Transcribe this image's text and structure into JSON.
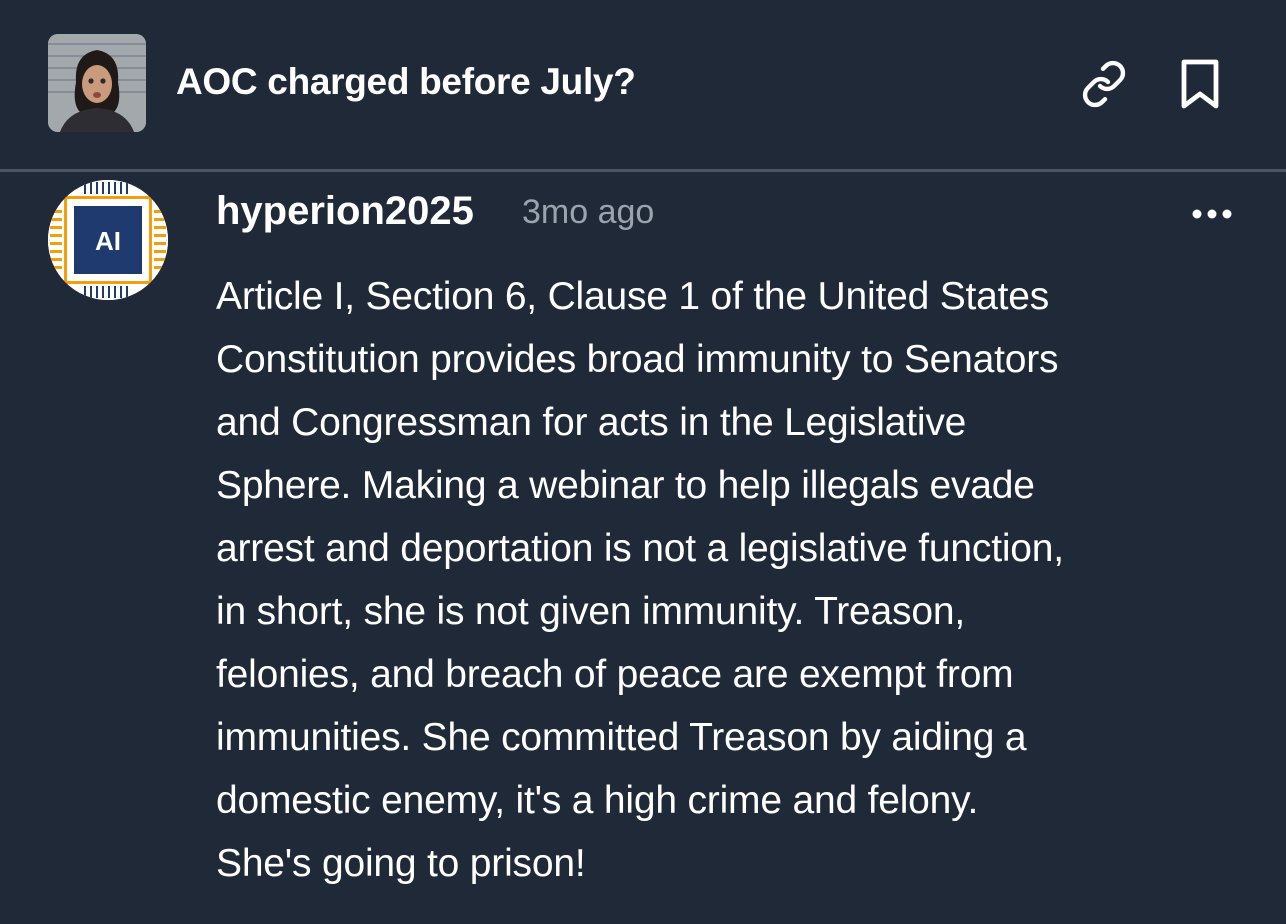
{
  "post": {
    "title": "AOC charged before July?",
    "thumbnail_icon": "mugshot-thumbnail"
  },
  "header_actions": {
    "link_icon": "link-icon",
    "bookmark_icon": "bookmark-icon"
  },
  "comment": {
    "avatar_text": "AI",
    "username": "hyperion2025",
    "timestamp": "3mo ago",
    "more_icon": "more-options-icon",
    "lines": [
      "Article I, Section 6, Clause 1 of the United States",
      "Constitution provides broad immunity to Senators",
      "and Congressman for acts in the Legislative",
      "Sphere. Making a webinar to help illegals evade",
      "arrest and deportation is not a legislative function,",
      "in short, she is not given immunity. Treason,",
      "felonies, and breach of peace are exempt from",
      "immunities. She committed Treason by aiding a",
      "domestic enemy, it's a high crime and felony.",
      "She's going to prison!"
    ]
  },
  "colors": {
    "background": "#1f2937",
    "divider": "#4b5563",
    "muted_text": "#9ca3af",
    "avatar_chip_blue": "#1e3a6e",
    "avatar_chip_orange": "#f59e0b"
  }
}
